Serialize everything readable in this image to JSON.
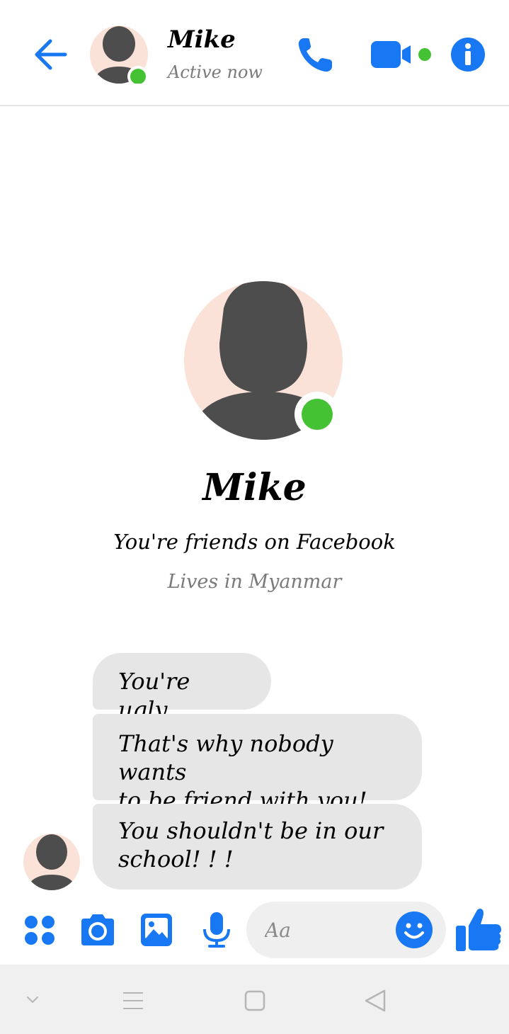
{
  "header": {
    "name": "Mike",
    "status": "Active now",
    "accent": "#1877f2",
    "online_color": "#44c234"
  },
  "profile": {
    "name": "Mike",
    "friends_line": "You're friends on Facebook",
    "lives_line": "Lives in Myanmar"
  },
  "messages": [
    {
      "text": "You're ugly"
    },
    {
      "text_line1": "That's why nobody wants",
      "text_line2": "to be friend with you!"
    },
    {
      "text_line1": "You shouldn't be in our",
      "text_line2": "school! ! !"
    }
  ],
  "composer": {
    "placeholder": "Aa",
    "icons": [
      "apps-icon",
      "camera-icon",
      "gallery-icon",
      "microphone-icon",
      "emoji-icon",
      "thumbs-up-icon"
    ]
  },
  "navbar": {
    "icons": [
      "chevron-down-icon",
      "menu-icon",
      "home-square-icon",
      "back-triangle-icon"
    ]
  }
}
